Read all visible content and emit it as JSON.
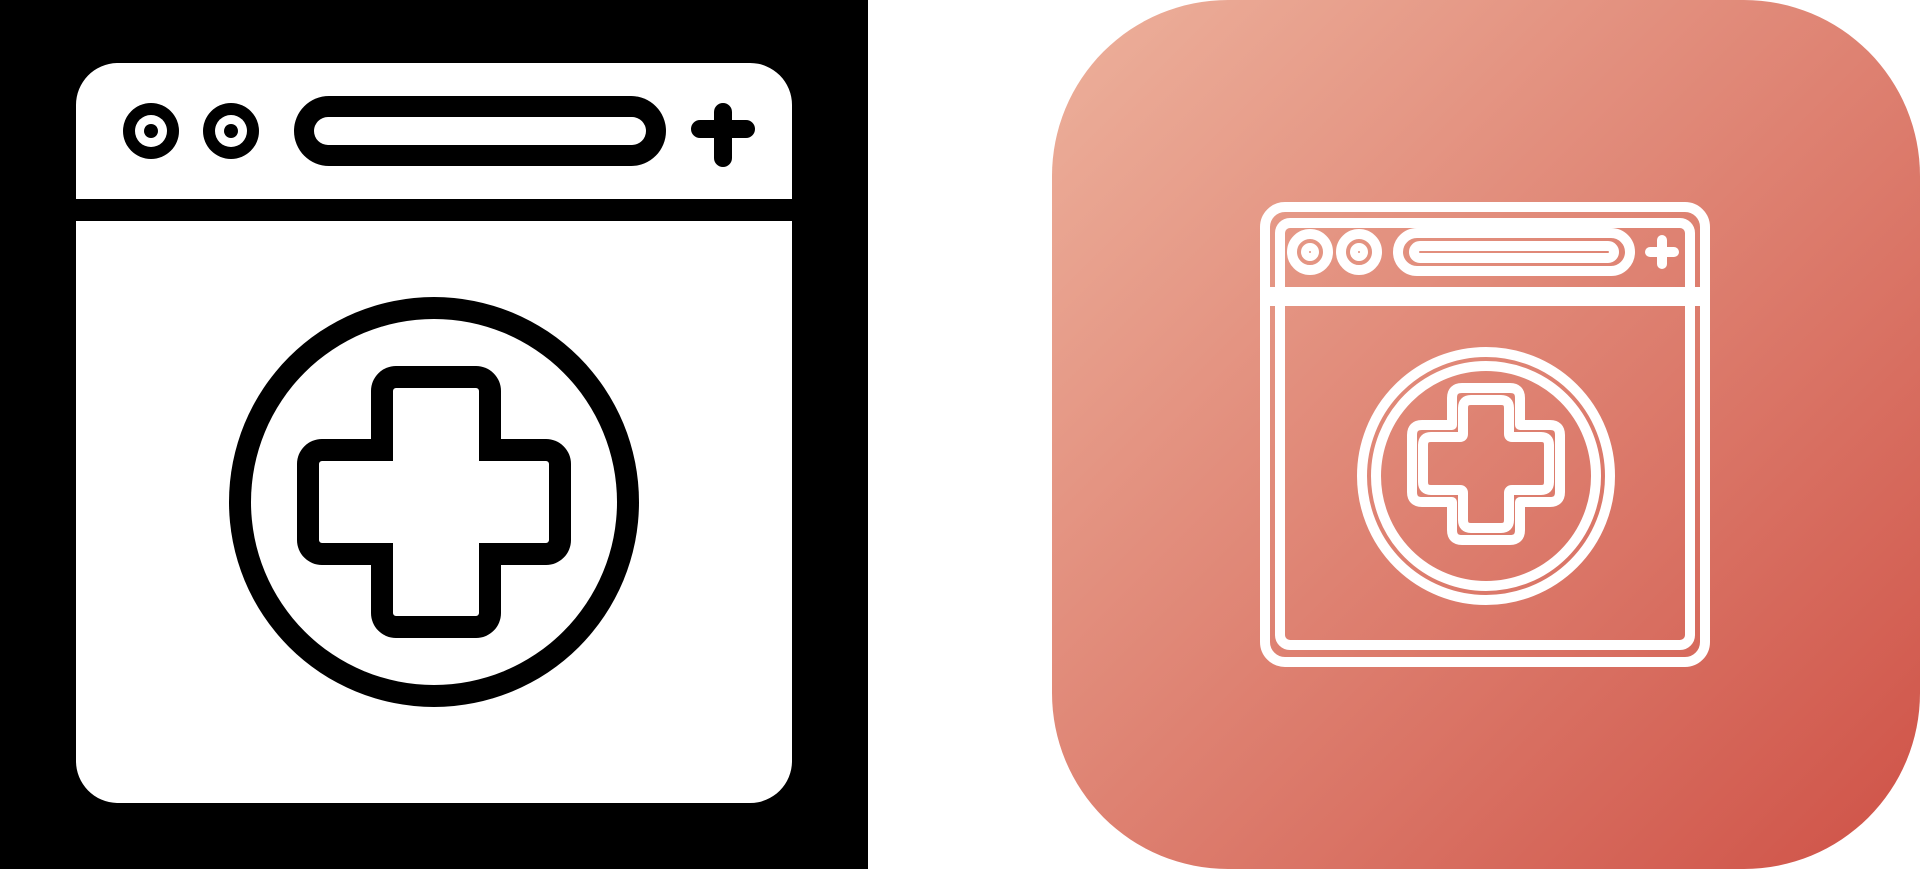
{
  "icons": [
    {
      "name": "medical-browser-glyph-icon",
      "style": "glyph",
      "colors": {
        "background": "#000000",
        "foreground": "#ffffff"
      }
    },
    {
      "name": "medical-browser-line-icon",
      "style": "line",
      "colors": {
        "gradient_start": "#EDB19C",
        "gradient_end": "#CF5247",
        "stroke": "#ffffff"
      }
    }
  ]
}
